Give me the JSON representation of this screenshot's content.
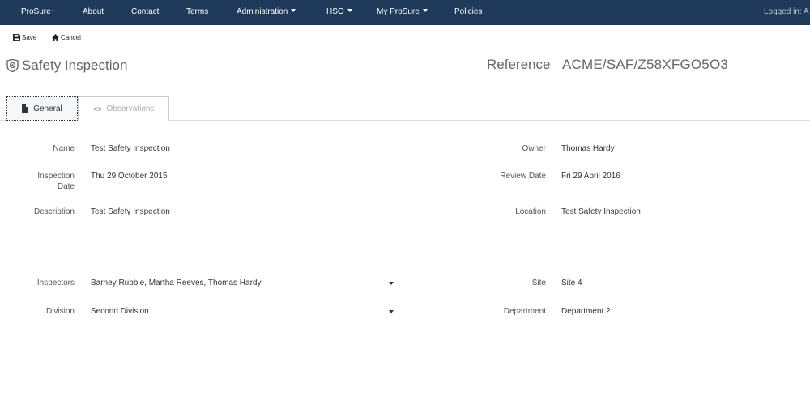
{
  "nav": {
    "items": [
      {
        "label": "ProSure+"
      },
      {
        "label": "About"
      },
      {
        "label": "Contact"
      },
      {
        "label": "Terms"
      },
      {
        "label": "Administration"
      },
      {
        "label": "HSO"
      },
      {
        "label": "My ProSure"
      },
      {
        "label": "Policies"
      }
    ],
    "logged_in": "Logged in: A"
  },
  "toolbar": {
    "save_label": "Save",
    "cancel_label": "Cancel"
  },
  "page": {
    "title": "Safety Inspection",
    "reference_label": "Reference",
    "reference_value": "ACME/SAF/Z58XFGO5O3"
  },
  "tabs": [
    {
      "label": "General",
      "active": true
    },
    {
      "label": "Observations",
      "active": false
    }
  ],
  "form": {
    "name_label": "Name",
    "name_value": "Test Safety Inspection",
    "owner_label": "Owner",
    "owner_value": "Thomas Hardy",
    "inspection_date_label_1": "Inspection",
    "inspection_date_label_2": "Date",
    "inspection_date_value": "Thu 29 October 2015",
    "review_date_label": "Review Date",
    "review_date_value": "Fri 29 April 2016",
    "description_label": "Description",
    "description_value": "Test Safety Inspection",
    "location_label": "Location",
    "location_value": "Test Safety Inspection",
    "inspectors_label": "Inspectors",
    "inspectors_value": "Barney Rubble, Martha Reeves, Thomas Hardy",
    "site_label": "Site",
    "site_value": "Site 4",
    "division_label": "Division",
    "division_value": "Second Division",
    "department_label": "Department",
    "department_value": "Department 2"
  },
  "colors": {
    "navbar": "#1f3a5a",
    "text": "#333333",
    "muted": "#aab0b8"
  }
}
